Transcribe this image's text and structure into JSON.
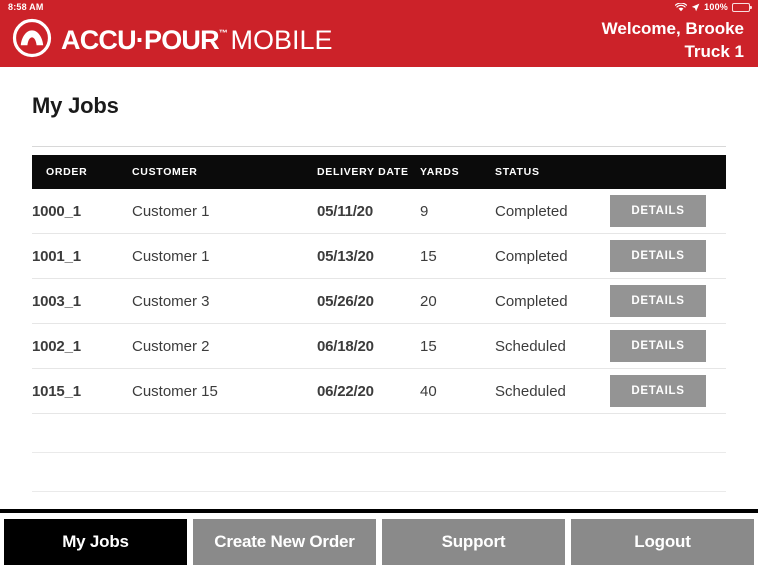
{
  "statusbar": {
    "time": "8:58 AM",
    "battery_percent": "100%",
    "wifi_icon": "wifi-icon",
    "location_icon": "location-arrow-icon",
    "battery_icon": "battery-full-icon"
  },
  "header": {
    "brand_bold": "ACCU·POUR",
    "brand_tm": "™",
    "brand_light": "MOBILE",
    "logo_icon": "accupour-logo-icon",
    "welcome_line1": "Welcome, Brooke",
    "welcome_line2": "Truck 1",
    "background_color": "#CC2229"
  },
  "main": {
    "page_title": "My Jobs"
  },
  "table": {
    "columns": [
      {
        "key": "order",
        "label": "ORDER"
      },
      {
        "key": "customer",
        "label": "CUSTOMER"
      },
      {
        "key": "date",
        "label": "DELIVERY DATE"
      },
      {
        "key": "yards",
        "label": "YARDS"
      },
      {
        "key": "status",
        "label": "STATUS"
      },
      {
        "key": "action",
        "label": ""
      }
    ],
    "details_label": "DETAILS",
    "rows": [
      {
        "order": "1000_1",
        "customer": "Customer 1",
        "date": "05/11/20",
        "yards": "9",
        "status": "Completed",
        "action": "DETAILS"
      },
      {
        "order": "1001_1",
        "customer": "Customer 1",
        "date": "05/13/20",
        "yards": "15",
        "status": "Completed",
        "action": "DETAILS"
      },
      {
        "order": "1003_1",
        "customer": "Customer 3",
        "date": "05/26/20",
        "yards": "20",
        "status": "Completed",
        "action": "DETAILS"
      },
      {
        "order": "1002_1",
        "customer": "Customer 2",
        "date": "06/18/20",
        "yards": "15",
        "status": "Scheduled",
        "action": "DETAILS"
      },
      {
        "order": "1015_1",
        "customer": "Customer 15",
        "date": "06/22/20",
        "yards": "40",
        "status": "Scheduled",
        "action": "DETAILS"
      }
    ],
    "empty_row_count": 3
  },
  "bottomnav": {
    "items": [
      {
        "label": "My Jobs",
        "active": true
      },
      {
        "label": "Create New Order",
        "active": false
      },
      {
        "label": "Support",
        "active": false
      },
      {
        "label": "Logout",
        "active": false
      }
    ]
  },
  "colors": {
    "brand_red": "#CC2229",
    "header_black": "#0b0b0b",
    "button_gray": "#949494",
    "nav_gray": "#8a8a8a"
  }
}
